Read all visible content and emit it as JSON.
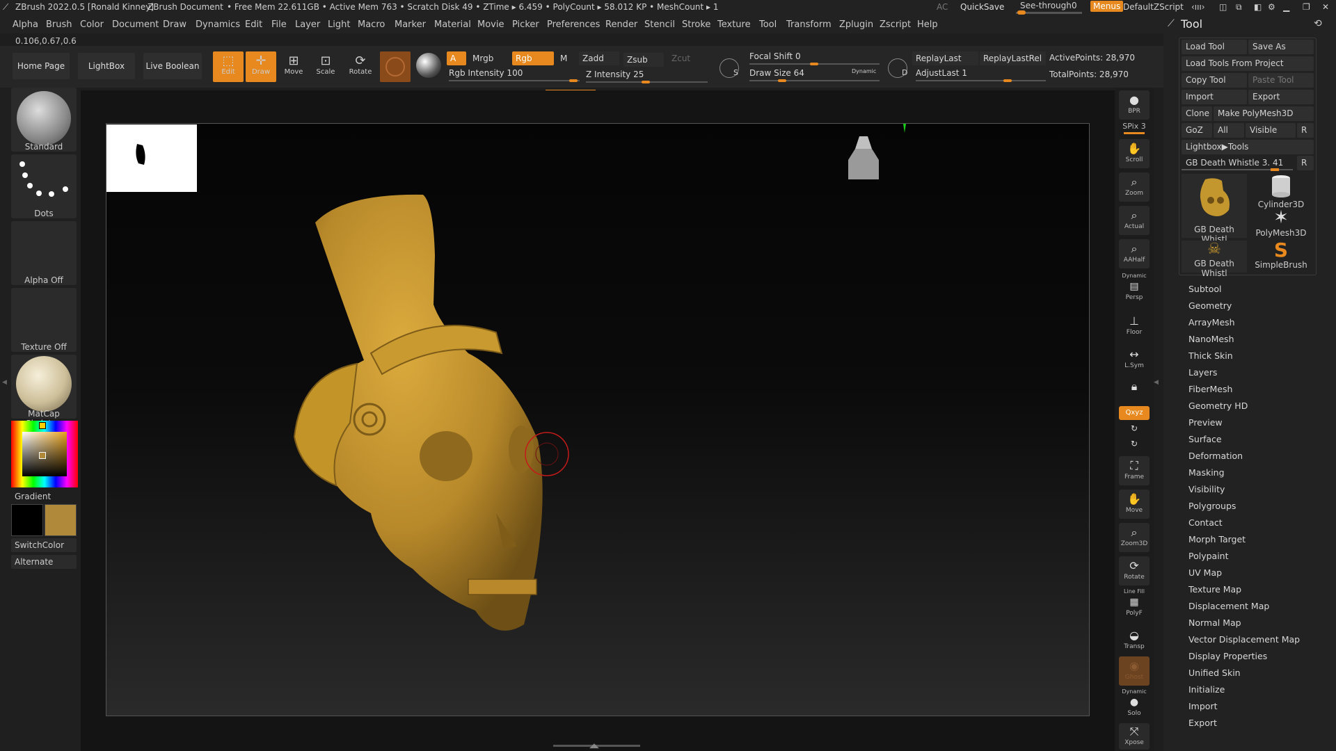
{
  "titlebar": {
    "app_title": "ZBrush 2022.0.5 [Ronald Kinney]",
    "document": "ZBrush Document",
    "stats": "• Free Mem 22.611GB • Active Mem 763 • Scratch Disk 49 • ZTime ▸ 6.459 • PolyCount ▸ 58.012 KP • MeshCount ▸ 1",
    "ac": "AC",
    "quicksave": "QuickSave",
    "seethrough_label": "See-through",
    "seethrough_value": "0",
    "seethrough_level": 0,
    "menus": "Menus",
    "script": "DefaultZScript"
  },
  "menubar": [
    "Alpha",
    "Brush",
    "Color",
    "Document",
    "Draw",
    "Dynamics",
    "Edit",
    "File",
    "Layer",
    "Light",
    "Macro",
    "Marker",
    "Material",
    "Movie",
    "Picker",
    "Preferences",
    "Render",
    "Stencil",
    "Stroke",
    "Texture",
    "Tool",
    "Transform",
    "Zplugin",
    "Zscript",
    "Help"
  ],
  "coords": "0.106,0.67,0.6",
  "shelf": {
    "home_page": "Home Page",
    "lightbox": "LightBox",
    "live_boolean": "Live Boolean",
    "edit": "Edit",
    "draw": "Draw",
    "move": "Move",
    "scale": "Scale",
    "rotate": "Rotate",
    "a": "A",
    "mrgb": "Mrgb",
    "rgb": "Rgb",
    "m": "M",
    "zadd": "Zadd",
    "zsub": "Zsub",
    "zcut": "Zcut",
    "rgb_intensity": "Rgb Intensity 100",
    "rgb_intensity_value": 100,
    "z_intensity": "Z Intensity 25",
    "z_intensity_value": 25,
    "focal_shift": "Focal Shift 0",
    "focal_shift_value": 0,
    "draw_size": "Draw Size 64",
    "draw_size_value": 64,
    "dynamic": "Dynamic",
    "replay_last": "ReplayLast",
    "replay_last_rel": "ReplayLastRel",
    "adjust_last": "AdjustLast 1",
    "adjust_last_value": 1,
    "active_points": "ActivePoints: 28,970",
    "total_points": "TotalPoints: 28,970",
    "s_label": "S",
    "d_label": "D"
  },
  "leftpanel": {
    "brush": "Standard",
    "stroke": "Dots",
    "alpha": "Alpha Off",
    "texture": "Texture Off",
    "material": "MatCap Skeleton",
    "gradient": "Gradient",
    "switchcolor": "SwitchColor",
    "alternate": "Alternate",
    "main_color": "#b08a3a",
    "secondary_color": "#000000"
  },
  "righttoolbar": {
    "bpr": "BPR",
    "spix": "SPix 3",
    "spix_value": 3,
    "scroll": "Scroll",
    "zoom": "Zoom",
    "actual": "Actual",
    "aahalf": "AAHalf",
    "dynamic": "Dynamic",
    "persp": "Persp",
    "floor": "Floor",
    "lsym": "L.Sym",
    "xyz": "Qxyz",
    "frame": "Frame",
    "move": "Move",
    "zoom3d": "Zoom3D",
    "rotate": "Rotate",
    "linefill": "Line Fill",
    "polyf": "PolyF",
    "transp": "Transp",
    "ghost": "Ghost",
    "dynamic2": "Dynamic",
    "solo": "Solo",
    "xpose": "Xpose"
  },
  "toolpanel": {
    "title": "Tool",
    "load_tool": "Load Tool",
    "save_as": "Save As",
    "load_from_project": "Load Tools From Project",
    "copy_tool": "Copy Tool",
    "paste_tool": "Paste Tool",
    "import": "Import",
    "export": "Export",
    "clone": "Clone",
    "make_polymesh": "Make PolyMesh3D",
    "goz": "GoZ",
    "all": "All",
    "visible": "Visible",
    "r": "R",
    "lightbox_tools": "Lightbox▶Tools",
    "current_tool": "GB Death Whistle 3. 41",
    "current_tool_level": 0.41,
    "thumbs": [
      "GB Death Whistl",
      "Cylinder3D",
      "PolyMesh3D",
      "GB Death Whistl",
      "SimpleBrush"
    ],
    "sections": [
      "Subtool",
      "Geometry",
      "ArrayMesh",
      "NanoMesh",
      "Thick Skin",
      "Layers",
      "FiberMesh",
      "Geometry HD",
      "Preview",
      "Surface",
      "Deformation",
      "Masking",
      "Visibility",
      "Polygroups",
      "Contact",
      "Morph Target",
      "Polypaint",
      "UV Map",
      "Texture Map",
      "Displacement Map",
      "Normal Map",
      "Vector Displacement Map",
      "Display Properties",
      "Unified Skin",
      "Initialize",
      "Import",
      "Export"
    ]
  },
  "colors": {
    "accent": "#e7891e",
    "model": "#c4962e",
    "brush_cursor": "#c41a1a"
  }
}
